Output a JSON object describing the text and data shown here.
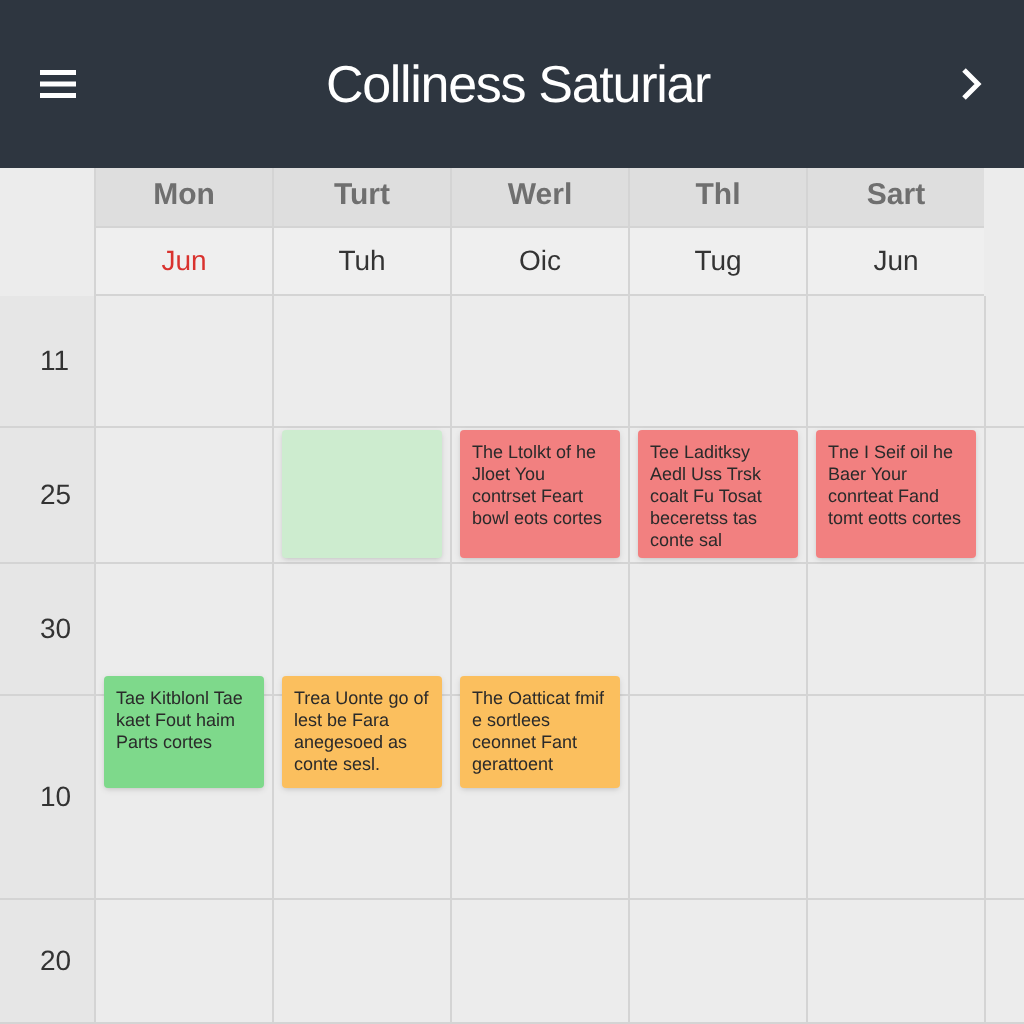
{
  "header": {
    "title": "Colliness Saturiar"
  },
  "days": [
    {
      "name": "Mon",
      "date": "Jun",
      "today": true
    },
    {
      "name": "Turt",
      "date": "Tuh",
      "today": false
    },
    {
      "name": "Werl",
      "date": "Oic",
      "today": false
    },
    {
      "name": "Thl",
      "date": "Tug",
      "today": false
    },
    {
      "name": "Sart",
      "date": "Jun",
      "today": false
    }
  ],
  "rows": [
    {
      "time": "11",
      "cells": [
        {},
        {},
        {},
        {},
        {}
      ]
    },
    {
      "time": "25",
      "cells": [
        {},
        {
          "event": {
            "color": "#cdeccf"
          }
        },
        {
          "event": {
            "color": "#f28080",
            "text": "The Ltolkt of he Jloet You contrset Feart bowl eots cortes"
          }
        },
        {
          "event": {
            "color": "#f28080",
            "text": "Tee Laditksy Aedl Uss Trsk coalt Fu Tosat beceretss tas conte sal"
          }
        },
        {
          "event": {
            "color": "#f28080",
            "text": "Tne I Seif oil he Baer Your conrteat Fand tomt eotts cortes"
          }
        }
      ]
    },
    {
      "time": "30",
      "cells": [
        {},
        {},
        {},
        {},
        {}
      ]
    },
    {
      "time": "10",
      "cells": [
        {
          "event": {
            "color": "#7ed98b",
            "text": "Tae Kitblonl Tae kaet Fout haim Parts cortes"
          }
        },
        {
          "event": {
            "color": "#fbbf5e",
            "text": "Trea Uonte go of lest be Fara anegesoed as conte sesl."
          }
        },
        {
          "event": {
            "color": "#fbbf5e",
            "text": "The Oatticat fmif e sortlees ceonnet Fant gerattoent"
          }
        },
        {},
        {}
      ]
    },
    {
      "time": "20",
      "cells": [
        {},
        {},
        {},
        {},
        {}
      ]
    }
  ]
}
